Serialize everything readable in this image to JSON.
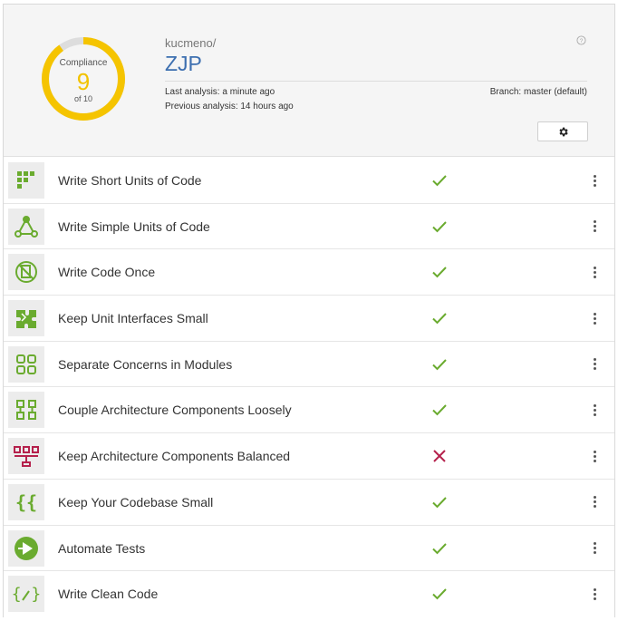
{
  "header": {
    "compliance_label": "Compliance",
    "compliance_score": "9",
    "compliance_of": "of 10",
    "compliance_fraction": 0.9,
    "owner": "kucmeno/",
    "project": "ZJP",
    "last_analysis": "Last analysis: a minute ago",
    "previous_analysis": "Previous analysis: 14 hours ago",
    "branch": "Branch: master (default)",
    "help_icon": "help-circle-icon",
    "settings_icon": "gear-icon"
  },
  "colors": {
    "gauge": "#f5c400",
    "gauge_track": "#dddddd",
    "project": "#3d6fb0",
    "pass": "#6aab2f",
    "fail": "#b5214c",
    "icon_green": "#6aab2f",
    "icon_red": "#b5214c"
  },
  "guidelines": [
    {
      "label": "Write Short Units of Code",
      "icon": "short-units-icon",
      "status": "pass"
    },
    {
      "label": "Write Simple Units of Code",
      "icon": "simple-units-icon",
      "status": "pass"
    },
    {
      "label": "Write Code Once",
      "icon": "code-once-icon",
      "status": "pass"
    },
    {
      "label": "Keep Unit Interfaces Small",
      "icon": "puzzle-icon",
      "status": "pass"
    },
    {
      "label": "Separate Concerns in Modules",
      "icon": "modules-icon",
      "status": "pass"
    },
    {
      "label": "Couple Architecture Components Loosely",
      "icon": "components-icon",
      "status": "pass"
    },
    {
      "label": "Keep Architecture Components Balanced",
      "icon": "balance-icon",
      "status": "fail"
    },
    {
      "label": "Keep Your Codebase Small",
      "icon": "braces-icon",
      "status": "pass"
    },
    {
      "label": "Automate Tests",
      "icon": "play-icon",
      "status": "pass"
    },
    {
      "label": "Write Clean Code",
      "icon": "clean-code-icon",
      "status": "pass"
    }
  ]
}
